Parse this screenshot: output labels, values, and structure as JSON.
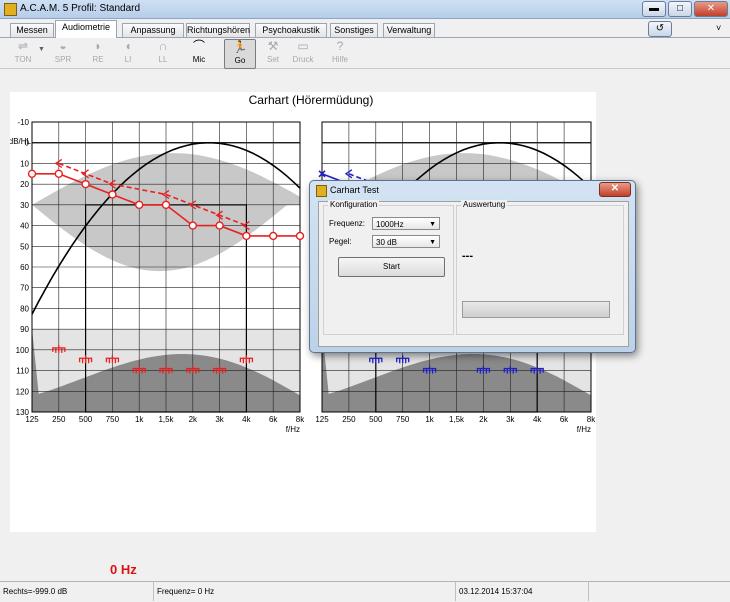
{
  "window": {
    "title": "A.C.A.M. 5  Profil: Standard",
    "minimize_glyph": "▬",
    "maximize_glyph": "□",
    "close_glyph": "✕",
    "help_glyph": "↺",
    "help_arrow": "˅"
  },
  "tabs": [
    "Messen",
    "Audiometrie",
    "Anpassung",
    "Richtungshören",
    "Psychoakustik",
    "Sonstiges",
    "Verwaltung"
  ],
  "toolbar": [
    {
      "label": "TON",
      "icon": "⇌",
      "icon_name": "tone-sliders-icon"
    },
    {
      "label": "SPR",
      "icon": "◒",
      "icon_name": "speech-cloud-icon"
    },
    {
      "label": "RE",
      "icon": "◗",
      "icon_name": "right-ear-icon"
    },
    {
      "label": "LI",
      "icon": "◖",
      "icon_name": "left-ear-icon"
    },
    {
      "label": "LL",
      "icon": "∩",
      "icon_name": "headphones-icon"
    },
    {
      "label": "Mic",
      "icon": "⌒",
      "icon_name": "microphone-icon"
    },
    {
      "label": "Go",
      "icon": "🏃",
      "icon_name": "running-man-icon"
    },
    {
      "label": "Set",
      "icon": "⚒",
      "icon_name": "tools-icon"
    },
    {
      "label": "Druck",
      "icon": "▭",
      "icon_name": "printer-icon"
    },
    {
      "label": "Hilfe",
      "icon": "?",
      "icon_name": "help-icon"
    }
  ],
  "chart_data": {
    "type": "line",
    "title": "Carhart (Hörermüdung)",
    "ylabel": "dB/HL",
    "xlabel": "f/Hz",
    "ylim": [
      -10,
      130
    ],
    "y_inverted": true,
    "y_ticks": [
      -10,
      0,
      10,
      20,
      30,
      40,
      50,
      60,
      70,
      80,
      90,
      100,
      110,
      120,
      130
    ],
    "x_ticks": [
      "125",
      "250",
      "500",
      "750",
      "1k",
      "1,5k",
      "2k",
      "3k",
      "4k",
      "6k",
      "8k"
    ],
    "left_panel": {
      "series": [
        {
          "name": "air_conduction_right",
          "color": "#e82020",
          "style": "solid-circle",
          "x": [
            "125",
            "250",
            "500",
            "750",
            "1k",
            "1,5k",
            "2k",
            "3k",
            "4k",
            "6k",
            "8k"
          ],
          "y": [
            15,
            15,
            20,
            25,
            30,
            30,
            40,
            40,
            45,
            45,
            45
          ]
        },
        {
          "name": "uncomfortable_level_right",
          "color": "#e82020",
          "style": "dashed-angle",
          "x": [
            "250",
            "500",
            "750",
            "1,5k",
            "2k",
            "3k",
            "4k"
          ],
          "y": [
            10,
            15,
            20,
            25,
            30,
            35,
            40
          ]
        },
        {
          "name": "bone_markers_right",
          "color": "#e82020",
          "style": "marker",
          "x": [
            "250",
            "500",
            "750",
            "1k",
            "1,5k",
            "2k",
            "3k",
            "4k"
          ],
          "y": [
            100,
            105,
            105,
            110,
            110,
            110,
            110,
            105
          ]
        }
      ]
    },
    "right_panel": {
      "series": [
        {
          "name": "air_conduction_left",
          "color": "#2020c8",
          "style": "solid-cross",
          "x": [
            "125",
            "250",
            "500",
            "750",
            "1k",
            "1,5k"
          ],
          "y": [
            15,
            20,
            25,
            30,
            30,
            30
          ]
        },
        {
          "name": "uncomfortable_level_left",
          "color": "#2020c8",
          "style": "dashed-angle",
          "x": [
            "250",
            "500",
            "750",
            "1k",
            "1,5k"
          ],
          "y": [
            15,
            20,
            25,
            28,
            30
          ]
        },
        {
          "name": "bone_markers_left",
          "color": "#2020c8",
          "style": "marker",
          "x": [
            "500",
            "750",
            "1k",
            "2k",
            "3k",
            "4k"
          ],
          "y": [
            105,
            105,
            110,
            110,
            110,
            110
          ]
        }
      ]
    }
  },
  "dialog": {
    "title": "Carhart Test",
    "config_group": "Konfiguration",
    "result_group": "Auswertung",
    "frequency_label": "Frequenz:",
    "frequency_value": "1000Hz",
    "level_label": "Pegel:",
    "level_value": "30 dB",
    "start_label": "Start",
    "result_value": "---",
    "close_glyph": "✕",
    "dropdown_glyph": "▼"
  },
  "frequency_display": "0 Hz",
  "status": {
    "left": "Rechts=-999.0 dB",
    "middle": "Frequenz= 0 Hz",
    "datetime": "03.12.2014 15:37:04"
  },
  "colors": {
    "right_ear": "#e82020",
    "left_ear": "#2020c8"
  }
}
